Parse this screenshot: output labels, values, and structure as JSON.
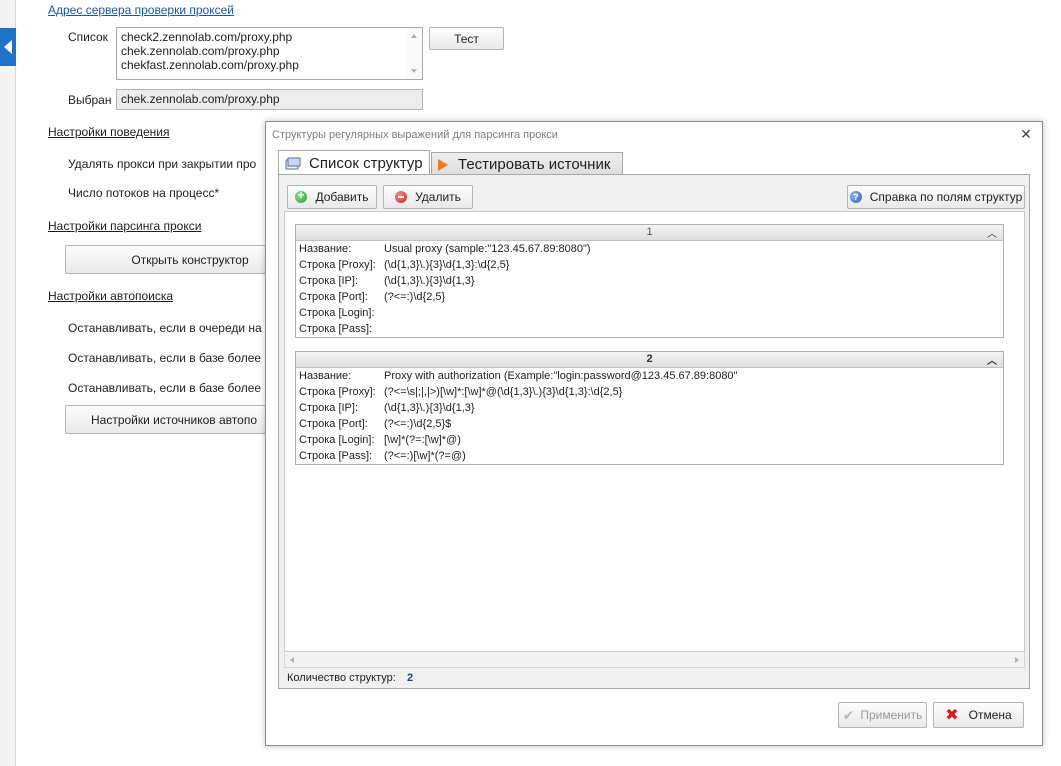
{
  "background": {
    "proxy_check_section": "Адрес сервера проверки проксей",
    "list_label": "Список",
    "list_items": [
      "check2.zennolab.com/proxy.php",
      "chek.zennolab.com/proxy.php",
      "chekfast.zennolab.com/proxy.php"
    ],
    "test_button": "Тест",
    "selected_label": "Выбран",
    "selected_value": "chek.zennolab.com/proxy.php",
    "behavior_section": "Настройки поведения",
    "delete_on_close": "Удалять прокси при закрытии про",
    "threads_per_process": "Число потоков на процесс*",
    "parsing_section": "Настройки парсинга прокси",
    "open_constructor_button": "Открыть конструктор",
    "autosearch_section": "Настройки автопоиска",
    "stop_if_queue": "Останавливать, если в очереди на",
    "stop_if_db_1": "Останавливать, если в базе более",
    "stop_if_db_2": "Останавливать, если в базе более",
    "sources_button": "Настройки источников автопо"
  },
  "dialog": {
    "title": "Структуры регулярных выражений для парсинга прокси",
    "tabs": [
      {
        "label": "Список структур"
      },
      {
        "label": "Тестировать источник"
      }
    ],
    "toolbar": {
      "add": "Добавить",
      "delete": "Удалить",
      "help": "Справка по полям структур"
    },
    "field_labels": {
      "name": "Название:",
      "proxy": "Строка [Proxy]:",
      "ip": "Строка [IP]:",
      "port": "Строка [Port]:",
      "login": "Строка [Login]:",
      "pass": "Строка [Pass]:"
    },
    "structures": [
      {
        "header": "1",
        "name": "Usual proxy (sample:\"123.45.67.89:8080\")",
        "proxy": "(\\d{1,3}\\.){3}\\d{1,3}:\\d{2,5}",
        "ip": "(\\d{1,3}\\.){3}\\d{1,3}",
        "port": "(?<=:)\\d{2,5}",
        "login": "",
        "pass": ""
      },
      {
        "header": "2",
        "name": "Proxy with authorization (Example:\"login:password@123.45.67.89:8080\"",
        "proxy": "(?<=\\s|;|,|>)[\\w]*:[\\w]*@(\\d{1,3}\\.){3}\\d{1,3}:\\d{2,5}",
        "ip": "(\\d{1,3}\\.){3}\\d{1,3}",
        "port": "(?<=:)\\d{2,5}$",
        "login": "[\\w]*(?=:[\\w]*@)",
        "pass": "(?<=:)[\\w]*(?=@)"
      }
    ],
    "count_label": "Количество структур:",
    "count_value": "2",
    "apply_button": "Применить",
    "cancel_button": "Отмена"
  },
  "colors": {
    "accent": "#1e73c8",
    "count_value": "#1a3fa0"
  }
}
